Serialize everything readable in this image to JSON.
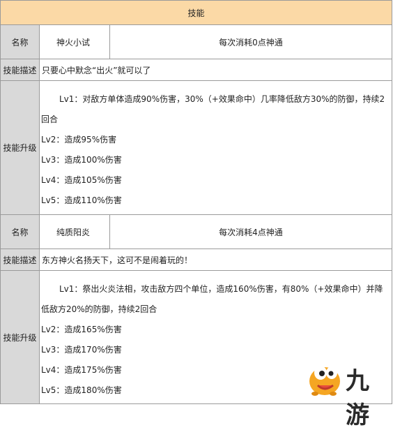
{
  "header": "技能",
  "labels": {
    "name": "名称",
    "desc": "技能描述",
    "upgrade": "技能升级"
  },
  "skills": [
    {
      "name": "神火小试",
      "cost": "每次消耗0点神通",
      "description": "只要心中默念“出火”就可以了",
      "lv1_part1": "Lv1：对敌方单体造成90%伤害，30%（+效果命中）几率降低敌方30%的防御，持续2",
      "lv1_part2": "回合",
      "lv2": "Lv2：造成95%伤害",
      "lv3": "Lv3：造成100%伤害",
      "lv4": "Lv4：造成105%伤害",
      "lv5": "Lv5：造成110%伤害"
    },
    {
      "name": "纯质阳炎",
      "cost": "每次消耗4点神通",
      "description": "东方神火名扬天下，这可不是闹着玩的！",
      "lv1_part1": "Lv1：祭出火炎法相，攻击敌方四个单位，造成160%伤害，有80%（+效果命中）并降",
      "lv1_part2": "低敌方20%的防御，持续2回合",
      "lv2": "Lv2：造成165%伤害",
      "lv3": "Lv3：造成170%伤害",
      "lv4": "Lv4：造成175%伤害",
      "lv5": "Lv5：造成180%伤害"
    }
  ],
  "watermark": {
    "text": "九游",
    "mascot": "jiuyou-mascot-icon",
    "colors": {
      "mascot": "#f5a623",
      "text": "#2a2a2a"
    }
  },
  "colors": {
    "header_bg": "#fbd9a6",
    "label_bg": "#d9d9d9",
    "border": "#9a9a9a"
  }
}
